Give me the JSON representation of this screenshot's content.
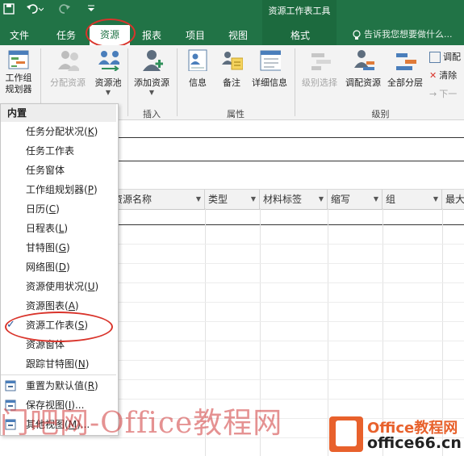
{
  "title_bar": {
    "quick_access": [
      "save-icon",
      "undo-icon",
      "redo-icon",
      "customize-icon"
    ],
    "tool_context_title": "资源工作表工具"
  },
  "tabs": [
    {
      "label": "文件"
    },
    {
      "label": "任务"
    },
    {
      "label": "资源",
      "active": true
    },
    {
      "label": "报表"
    },
    {
      "label": "项目"
    },
    {
      "label": "视图"
    },
    {
      "label": "格式"
    }
  ],
  "tell_me": "告诉我您想要做什么...",
  "ribbon": {
    "team_planner": "工作组\n规划器",
    "assign_resources": "分配资源",
    "resource_pool": "资源池",
    "add_resources": "添加资源",
    "info": "信息",
    "notes": "备注",
    "details": "详细信息",
    "level_selection": "级别选择",
    "level_resource": "调配资源",
    "level_all": "全部分层",
    "small_adjust": "调配",
    "small_clear": "清除",
    "small_next": "下一",
    "group_insert": "插入",
    "group_properties": "属性",
    "group_level": "级别"
  },
  "menu": {
    "header": "内置",
    "items": [
      {
        "label": "任务分配状况",
        "key": "K"
      },
      {
        "label": "任务工作表",
        "key": ""
      },
      {
        "label": "任务窗体",
        "key": ""
      },
      {
        "label": "工作组规划器",
        "key": "P"
      },
      {
        "label": "日历",
        "key": "C"
      },
      {
        "label": "日程表",
        "key": "L"
      },
      {
        "label": "甘特图",
        "key": "G"
      },
      {
        "label": "网络图",
        "key": "D"
      },
      {
        "label": "资源使用状况",
        "key": "U"
      },
      {
        "label": "资源图表",
        "key": "A"
      },
      {
        "label": "资源工作表",
        "key": "S",
        "checked": true
      },
      {
        "label": "资源窗体",
        "key": ""
      },
      {
        "label": "跟踪甘特图",
        "key": "N"
      }
    ],
    "actions": [
      {
        "label": "重置为默认值",
        "key": "R"
      },
      {
        "label": "保存视图",
        "key": "I",
        "suffix": "..."
      },
      {
        "label": "其他视图",
        "key": "M",
        "suffix": "..."
      }
    ]
  },
  "grid": {
    "columns": [
      "资源名称",
      "类型",
      "材料标签",
      "缩写",
      "组",
      "最大"
    ]
  },
  "watermark": {
    "text": "门吧网-Office教程网",
    "logo_line1": "Office教程网",
    "logo_line2": "office66.cn"
  }
}
